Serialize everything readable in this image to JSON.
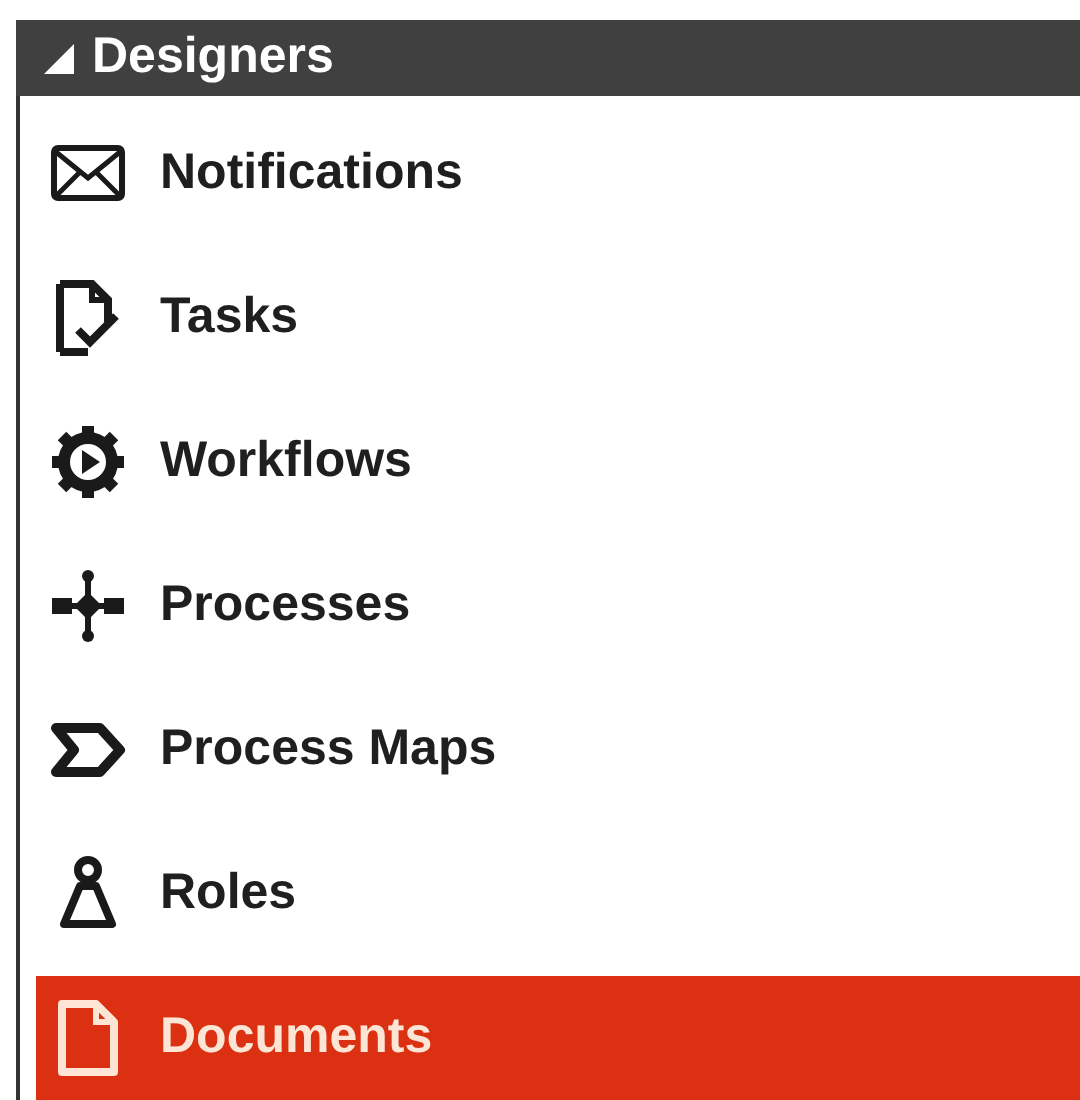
{
  "panel": {
    "title": "Designers",
    "expanded": true
  },
  "items": [
    {
      "label": "Notifications",
      "selected": false
    },
    {
      "label": "Tasks",
      "selected": false
    },
    {
      "label": "Workflows",
      "selected": false
    },
    {
      "label": "Processes",
      "selected": false
    },
    {
      "label": "Process Maps",
      "selected": false
    },
    {
      "label": "Roles",
      "selected": false
    },
    {
      "label": "Documents",
      "selected": true
    }
  ]
}
